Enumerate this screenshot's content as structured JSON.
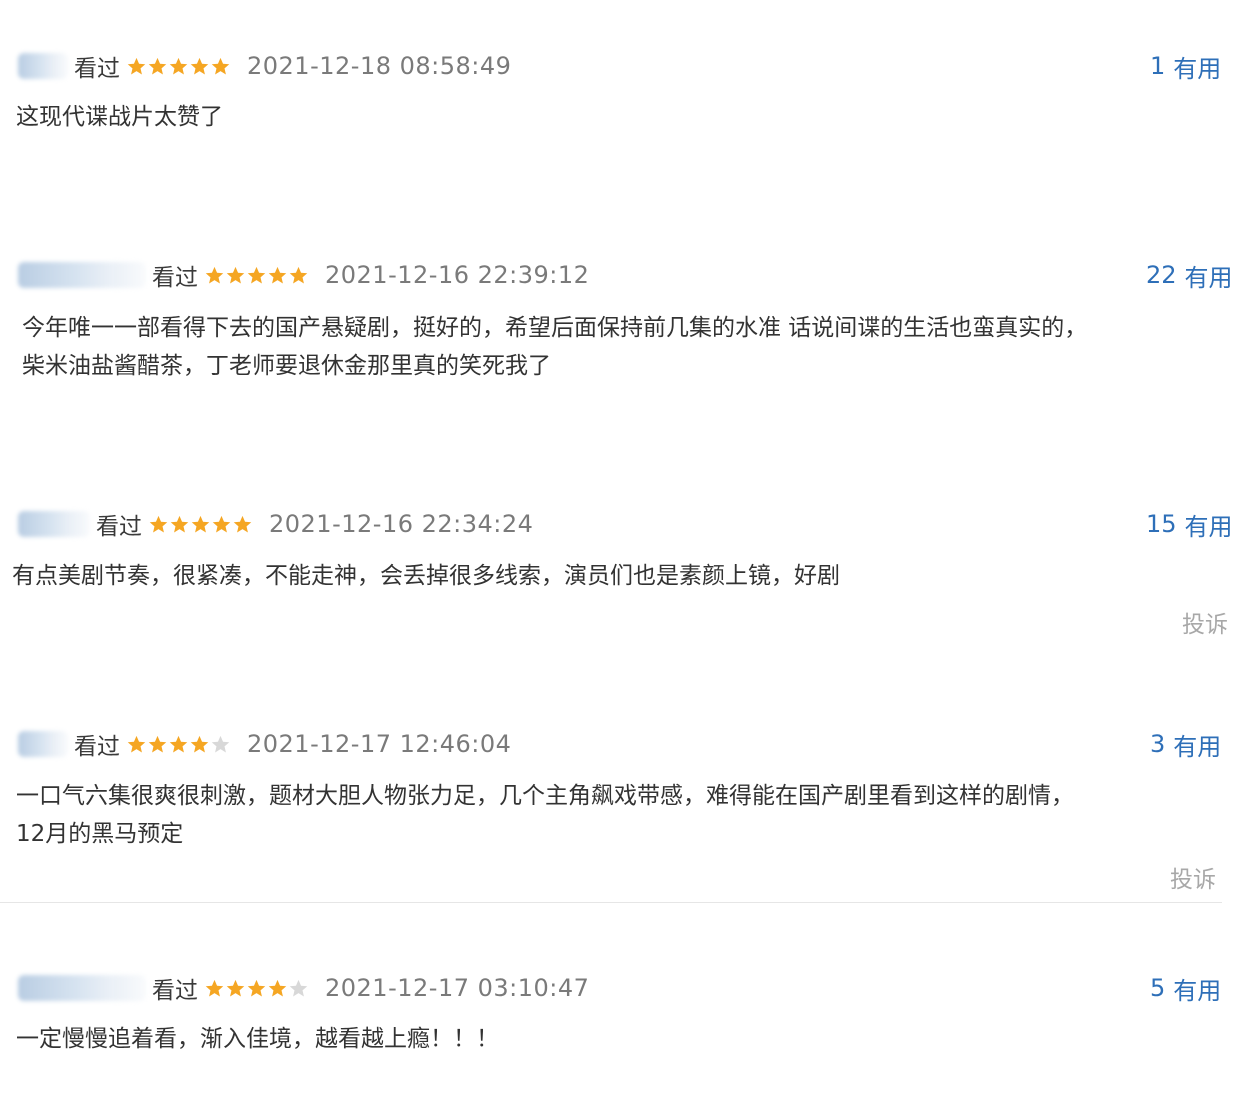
{
  "reviews": [
    {
      "watched": "看过",
      "rating": 5,
      "time": "2021-12-18 08:58:49",
      "useful_count": "1",
      "useful_label": "有用",
      "content_lines": [
        "这现代谍战片太赞了"
      ]
    },
    {
      "watched": "看过",
      "rating": 5,
      "time": "2021-12-16 22:39:12",
      "useful_count": "22",
      "useful_label": "有用",
      "content_lines": [
        "今年唯一一部看得下去的国产悬疑剧，挺好的，希望后面保持前几集的水准 话说间谍的生活也蛮真实的，",
        "柴米油盐酱醋茶，丁老师要退休金那里真的笑死我了"
      ]
    },
    {
      "watched": "看过",
      "rating": 5,
      "time": "2021-12-16 22:34:24",
      "useful_count": "15",
      "useful_label": "有用",
      "content_lines": [
        "有点美剧节奏，很紧凑，不能走神，会丢掉很多线索，演员们也是素颜上镜，好剧"
      ],
      "report": "投诉"
    },
    {
      "watched": "看过",
      "rating": 4,
      "time": "2021-12-17 12:46:04",
      "useful_count": "3",
      "useful_label": "有用",
      "content_lines": [
        "一口气六集很爽很刺激，题材大胆人物张力足，几个主角飙戏带感，难得能在国产剧里看到这样的剧情，",
        "12月的黑马预定"
      ],
      "report": "投诉"
    },
    {
      "watched": "看过",
      "rating": 4,
      "time": "2021-12-17 03:10:47",
      "useful_count": "5",
      "useful_label": "有用",
      "content_lines": [
        "一定慢慢追着看，渐入佳境，越看越上瘾！！！"
      ]
    }
  ],
  "colors": {
    "star_filled": "#f5a623",
    "star_empty": "#d8d8d8",
    "useful": "#2e6fb8",
    "report": "#a8a8a8"
  },
  "icons": {
    "star": "star-icon",
    "avatar": "avatar"
  }
}
